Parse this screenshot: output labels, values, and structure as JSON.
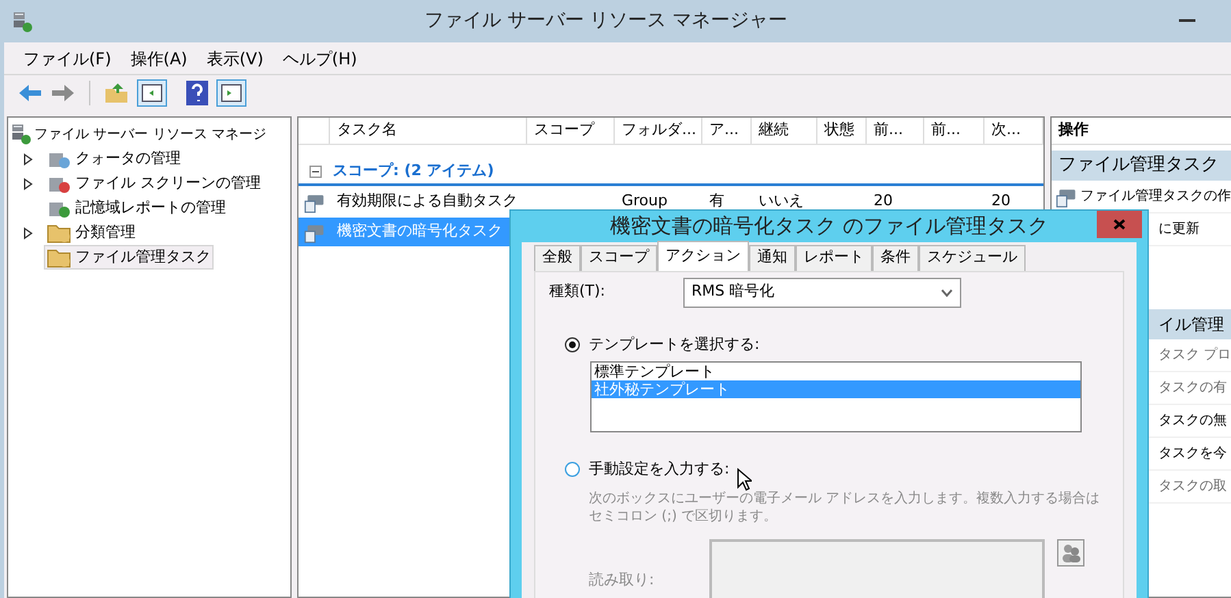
{
  "window": {
    "title": "ファイル サーバー リソース マネージャー"
  },
  "menu": [
    "ファイル(F)",
    "操作(A)",
    "表示(V)",
    "ヘルプ(H)"
  ],
  "tree": {
    "label": "ファイル サーバー リソース マネージ",
    "children": [
      {
        "label": "クォータの管理",
        "expandable": true,
        "selected": false,
        "kind": "quota"
      },
      {
        "label": "ファイル スクリーンの管理",
        "expandable": true,
        "selected": false,
        "kind": "screen"
      },
      {
        "label": "記憶域レポートの管理",
        "expandable": false,
        "selected": false,
        "kind": "report"
      },
      {
        "label": "分類管理",
        "expandable": true,
        "selected": false,
        "kind": "folder"
      },
      {
        "label": "ファイル管理タスク",
        "expandable": false,
        "selected": true,
        "kind": "folder"
      }
    ]
  },
  "table": {
    "columns": [
      "タスク名",
      "スコープ",
      "フォルダ...",
      "ア...",
      "継続",
      "状態",
      "前...",
      "前...",
      "次..."
    ],
    "group": "スコープ: (2 アイテム)",
    "rows": [
      {
        "selected": false,
        "cells": [
          "有効期限による自動タスク",
          "",
          "Group",
          "有",
          "いいえ",
          "",
          "20",
          "",
          "20"
        ]
      },
      {
        "selected": true,
        "cells": [
          "機密文書の暗号化タスク"
        ]
      }
    ]
  },
  "actions": {
    "title": "操作",
    "sections": [
      {
        "title": "ファイル管理タスク",
        "kind": "full",
        "items": [
          {
            "label": "ファイル管理タスクの作",
            "kind": "icon",
            "disabled": false
          },
          {
            "label": "に更新",
            "kind": "partial",
            "disabled": false
          }
        ]
      },
      {
        "title": "イル管理",
        "kind": "partial",
        "items": [
          {
            "label": "タスク プロ",
            "kind": "partial",
            "disabled": true
          },
          {
            "label": "タスクの有",
            "kind": "partial",
            "disabled": true
          },
          {
            "label": "タスクの無",
            "kind": "partial",
            "disabled": false
          },
          {
            "label": "タスクを今",
            "kind": "partial",
            "disabled": false
          },
          {
            "label": "タスクの取",
            "kind": "partial",
            "disabled": true
          }
        ]
      }
    ]
  },
  "dialog": {
    "title": "機密文書の暗号化タスク のファイル管理タスク",
    "tabs": [
      {
        "label": "全般",
        "selected": false
      },
      {
        "label": "スコープ",
        "selected": false
      },
      {
        "label": "アクション",
        "selected": true
      },
      {
        "label": "通知",
        "selected": false
      },
      {
        "label": "レポート",
        "selected": false
      },
      {
        "label": "条件",
        "selected": false
      },
      {
        "label": "スケジュール",
        "selected": false
      }
    ],
    "type_label": "種類(T):",
    "type_value": "RMS 暗号化",
    "options": [
      {
        "kind": "templates",
        "label": "テンプレートを選択する:",
        "selected": true,
        "templates": [
          {
            "label": "標準テンプレート",
            "selected": false
          },
          {
            "label": "社外秘テンプレート",
            "selected": true
          }
        ]
      },
      {
        "kind": "manual",
        "label": "手動設定を入力する:",
        "selected": false,
        "hint": "次のボックスにユーザーの電子メール アドレスを入力します。複数入力する場合はセミコロン (;) で区切ります。",
        "field_label": "読み取り:"
      }
    ]
  }
}
